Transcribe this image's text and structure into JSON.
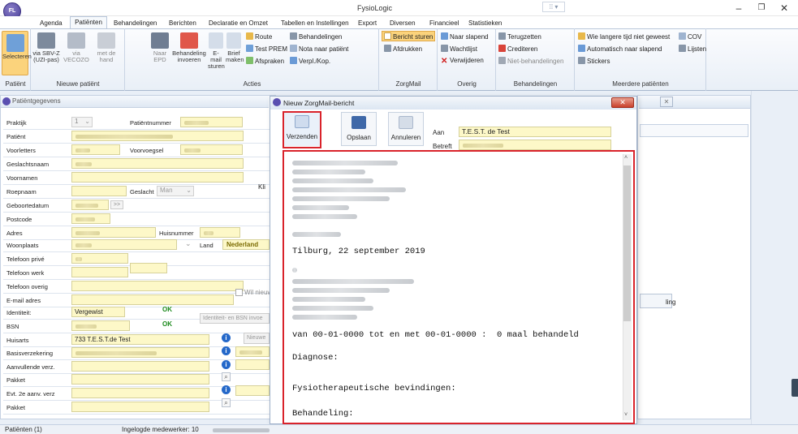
{
  "app": {
    "title": "FysioLogic",
    "logo": "FL"
  },
  "menu": [
    "Agenda",
    "Patiënten",
    "Behandelingen",
    "Berichten",
    "Declaratie en Omzet",
    "Tabellen en Instellingen",
    "Export",
    "Diversen",
    "Financieel",
    "Statistieken"
  ],
  "ribbon": {
    "patient_group": {
      "label": "Patiënt",
      "btn": "Selecteren"
    },
    "new_patient_group": {
      "label": "Nieuwe patiënt",
      "btns": [
        "via SBV-Z (UZI-pas)",
        "via VECOZO",
        "met de hand"
      ]
    },
    "acties_group": {
      "label": "Acties",
      "big": [
        "Naar EPD",
        "Behandeling invoeren",
        "E-mail sturen",
        "Brief maken"
      ],
      "small": [
        "Route",
        "Test PREM",
        "Afspraken",
        "Behandelingen",
        "Nota naar patiënt",
        "Verpl./Kop."
      ]
    },
    "zorgmail_group": {
      "label": "ZorgMail",
      "small": [
        "Bericht sturen",
        "Afdrukken"
      ]
    },
    "overig_group": {
      "label": "Overig",
      "small": [
        "Naar slapend",
        "Wachtlijst",
        "Verwijderen"
      ]
    },
    "behandelingen_group": {
      "label": "Behandelingen",
      "small": [
        "Terugzetten",
        "Crediteren",
        "Niet-behandelingen"
      ]
    },
    "meerdere_group": {
      "label": "Meerdere patiënten",
      "small": [
        "Wie langere tijd niet geweest",
        "Automatisch naar slapend",
        "Stickers",
        "COV",
        "Lijsten"
      ]
    }
  },
  "patient_panel": {
    "title": "Patiëntgegevens",
    "labels": [
      "Praktijk",
      "Patiënt",
      "Voorletters",
      "Geslachtsnaam",
      "Voornamen",
      "Roepnaam",
      "Geboortedatum",
      "Postcode",
      "Adres",
      "Woonplaats",
      "Telefoon privé",
      "Telefoon werk",
      "Telefoon overig",
      "E-mail adres",
      "Identiteit:",
      "BSN",
      "Huisarts",
      "Basisverzekering",
      "Aanvullende verz.",
      "Pakket",
      "Evt. 2e aanv. verz",
      "Pakket"
    ],
    "praktijk_value": "1",
    "patientnummer_label": "Patiëntnummer",
    "voorvoegsel_label": "Voorvoegsel",
    "geslacht_label": "Geslacht",
    "geslacht_value": "Man",
    "huisnummer_label": "Huisnummer",
    "land_label": "Land",
    "land_value": "Nederland",
    "identiteit_value": "Vergewist",
    "ok1": "OK",
    "ok2": "OK",
    "huisarts_value": "733 T.E.S.T.de Test",
    "wil_nieuws": "Wil nieuw",
    "identiteit_btn": "Identiteit- en BSN invoe",
    "nieuw_btn": "Nieuwe",
    "klik": "Kli",
    "arrow": ">>"
  },
  "dialog": {
    "title": "Nieuw ZorgMail-bericht",
    "btn_send": "Verzenden",
    "btn_save": "Opslaan",
    "btn_cancel": "Annuleren",
    "aan_label": "Aan",
    "aan_value": "T.E.S.T. de Test",
    "betreft_label": "Betreft",
    "body": {
      "date_line": "Tilburg, 22 september 2019",
      "period_line": "van 00-01-0000 tot en met 00-01-0000 :  0 maal behandeld",
      "diagnose": "Diagnose:",
      "bevindingen": "Fysiotherapeutische bevindingen:",
      "behandeling": "Behandeling:"
    }
  },
  "right_panel": {
    "ling": "ling"
  },
  "status": {
    "left": "Patiënten (1)",
    "user": "Ingelogde medewerker: 10"
  },
  "colors": {
    "highlight_box": "#d9232b",
    "field_yellow": "#fdf8c8",
    "ribbon_bg": "#e9eff7"
  }
}
